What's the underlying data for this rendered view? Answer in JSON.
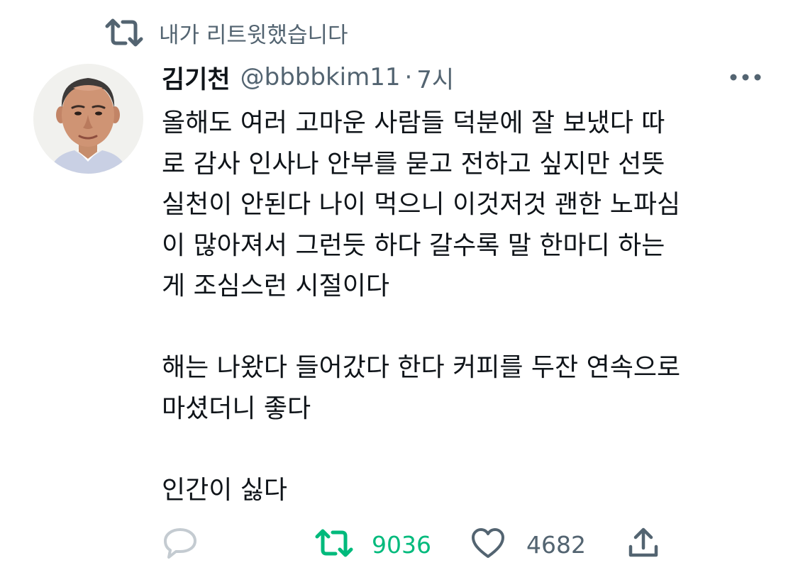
{
  "retweet_banner": {
    "icon": "retweet-icon",
    "text": "내가 리트윗했습니다"
  },
  "tweet": {
    "avatar": "avatar",
    "display_name": "김기천",
    "handle": "@bbbbkim11",
    "separator": "·",
    "time": "7시",
    "more_icon": "more-icon",
    "paragraphs": [
      {
        "lines": [
          "올해도 여러 고마운 사람들 덕분에 잘 보냈다 따",
          "로 감사 인사나 안부를 묻고 전하고 싶지만 선뜻",
          "실천이 안된다 나이 먹으니 이것저것 괜한 노파심",
          "이 많아져서 그런듯 하다 갈수록 말 한마디 하는",
          "게 조심스런 시절이다"
        ]
      },
      {
        "lines": [
          "해는 나왔다 들어갔다 한다 커피를 두잔 연속으로",
          "마셨더니 좋다"
        ]
      },
      {
        "lines": [
          "인간이 싫다"
        ]
      }
    ]
  },
  "actions": {
    "reply": {
      "icon": "reply-icon"
    },
    "retweet": {
      "icon": "retweet-icon",
      "count": "9036",
      "color": "#00ba7c"
    },
    "like": {
      "icon": "heart-icon",
      "count": "4682"
    },
    "share": {
      "icon": "share-icon"
    }
  },
  "colors": {
    "secondary_text": "#536471",
    "primary_text": "#0f1419",
    "retweet_active": "#00ba7c"
  }
}
